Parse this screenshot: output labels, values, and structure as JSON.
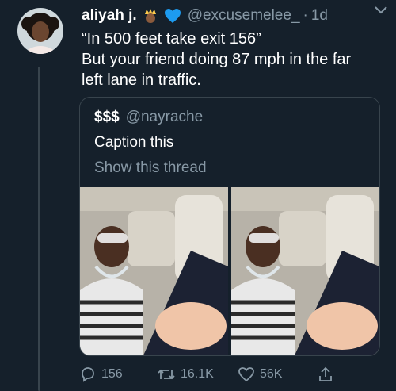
{
  "tweet": {
    "display_name": "aliyah j.",
    "name_emojis": [
      "crown-face-emoji",
      "blue-heart-emoji"
    ],
    "handle": "@excusemelee_",
    "separator": "·",
    "time": "1d",
    "text_lines": [
      "“In 500 feet take exit 156”",
      "But your friend doing 87 mph in the far",
      "left lane in traffic."
    ]
  },
  "quote": {
    "display_name": "$$$",
    "handle": "@nayrache",
    "text": "Caption this",
    "thread_link": "Show this thread",
    "media_count": 2
  },
  "actions": {
    "replies": "156",
    "retweets": "16.1K",
    "likes": "56K"
  },
  "colors": {
    "background": "#15202b",
    "border": "#38444d",
    "text_primary": "#ffffff",
    "text_secondary": "#8899a6",
    "heart": "#1d9bf0"
  }
}
